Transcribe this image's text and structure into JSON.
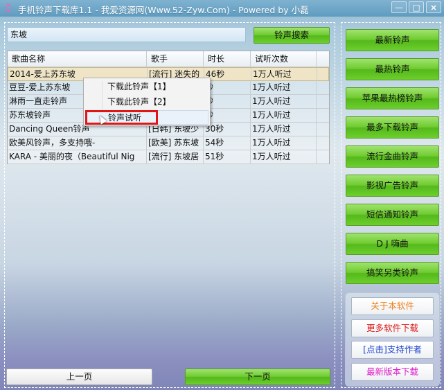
{
  "window": {
    "title": "手机铃声下载库1.1 - 我爱资源网(Www.52-Zyw.Com) - Powered by 小磊",
    "icon": "music-note-icon",
    "controls": {
      "minimize": "—",
      "maximize": "□",
      "close": "×"
    }
  },
  "search": {
    "value": "东坡",
    "button_label": "铃声搜索"
  },
  "table": {
    "columns": [
      "歌曲名称",
      "歌手",
      "时长",
      "试听次数"
    ],
    "rows": [
      [
        "2014-爱上苏东坡",
        "[流行] 迷失的",
        "46秒",
        "1万人听过"
      ],
      [
        "豆豆-爱上苏东坡",
        "",
        "秒",
        "1万人听过"
      ],
      [
        "淋雨一直走铃声",
        "",
        "秒",
        "1万人听过"
      ],
      [
        "苏东坡铃声",
        "",
        "秒",
        "1万人听过"
      ],
      [
        "Dancing Queen铃声",
        "[日韩] 东坡少",
        "30秒",
        "1万人听过"
      ],
      [
        "欧美风铃声，多支持哦-",
        "[欧美] 苏东坡",
        "54秒",
        "1万人听过"
      ],
      [
        "KARA - 美丽的夜（Beautiful Nig",
        "[流行] 东坡居",
        "51秒",
        "1万人听过"
      ]
    ],
    "selected_row": 0
  },
  "context_menu": {
    "items": [
      "下载此铃声【1】",
      "下载此铃声【2】",
      "铃声试听"
    ],
    "highlighted_item": 2
  },
  "pagination": {
    "prev_label": "上一页",
    "next_label": "下一页"
  },
  "categories": [
    "最新铃声",
    "最热铃声",
    "苹果最热榜铃声",
    "最多下载铃声",
    "流行金曲铃声",
    "影视广告铃声",
    "短信通知铃声",
    "D J 嗨曲",
    "搞笑另类铃声"
  ],
  "links": [
    {
      "label": "关于本软件",
      "color": "#f0801a"
    },
    {
      "label": "更多软件下载",
      "color": "#e01818"
    },
    {
      "label": "[点击]支持作者",
      "color": "#1a3fd0"
    },
    {
      "label": "最新版本下载",
      "color": "#e018c8"
    }
  ],
  "colors": {
    "green_button": "#6fcb2f",
    "highlight_box": "#e01515",
    "selected_row": "#efe5c6"
  }
}
